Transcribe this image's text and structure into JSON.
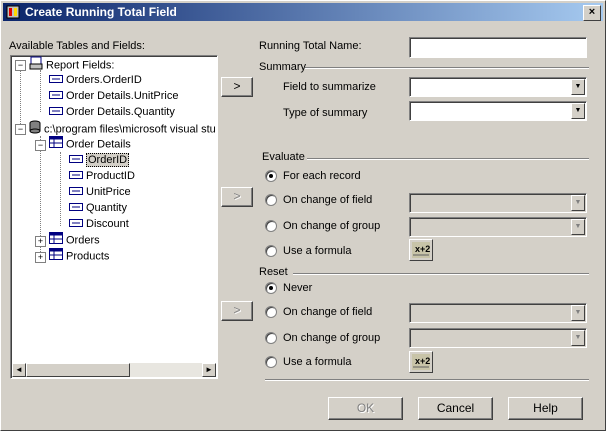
{
  "window": {
    "title": "Create Running Total Field",
    "close_glyph": "×"
  },
  "tree": {
    "header": "Available Tables and Fields:",
    "items": [
      {
        "label": "Report Fields:"
      },
      {
        "label": "Orders.OrderID"
      },
      {
        "label": "Order Details.UnitPrice"
      },
      {
        "label": "Order Details.Quantity"
      },
      {
        "label": "c:\\program files\\microsoft visual stu"
      },
      {
        "label": "Order Details"
      },
      {
        "label": "OrderID"
      },
      {
        "label": "ProductID"
      },
      {
        "label": "UnitPrice"
      },
      {
        "label": "Quantity"
      },
      {
        "label": "Discount"
      },
      {
        "label": "Orders"
      },
      {
        "label": "Products"
      }
    ],
    "scroll_left": "◄",
    "scroll_right": "►"
  },
  "form": {
    "running_total_name_label": "Running Total Name:",
    "running_total_name_value": "",
    "summary_section": "Summary",
    "field_to_summarize_label": "Field to summarize",
    "type_of_summary_label": "Type of summary",
    "evaluate_section": "Evaluate",
    "reset_section": "Reset",
    "evaluate_options": [
      "For each record",
      "On change of field",
      "On change of group",
      "Use a formula"
    ],
    "reset_options": [
      "Never",
      "On change of field",
      "On change of group",
      "Use a formula"
    ],
    "evaluate_selected": "For each record",
    "reset_selected": "Never",
    "arrow_label": ">",
    "combo_arrow": "▼"
  },
  "buttons": {
    "ok": "OK",
    "cancel": "Cancel",
    "help": "Help"
  },
  "colors": {
    "title_start": "#0a246a",
    "title_end": "#a6caf0",
    "face": "#d4d0c8"
  }
}
